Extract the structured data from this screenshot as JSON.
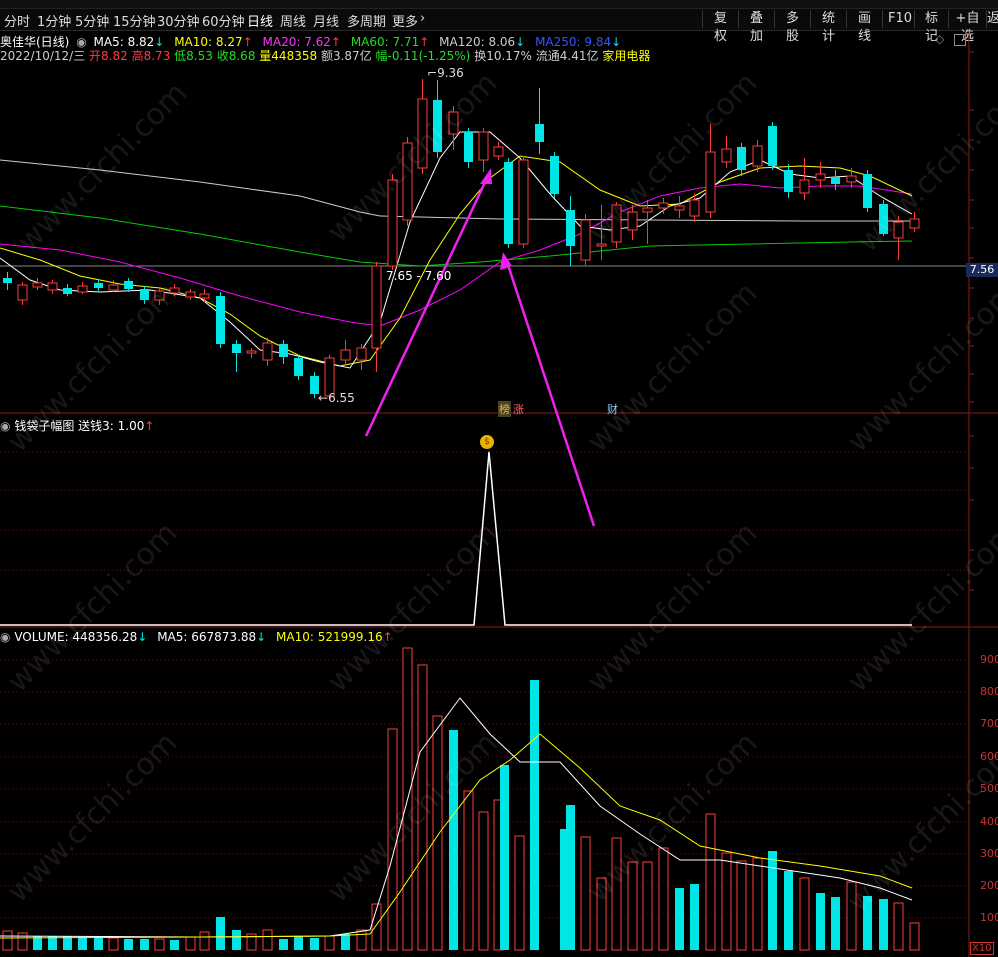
{
  "toolbar": {
    "period_tabs": [
      "分时",
      "1分钟",
      "5分钟",
      "15分钟",
      "30分钟",
      "60分钟",
      "日线",
      "周线",
      "月线",
      "多周期",
      "更多"
    ],
    "active_tab": "日线",
    "right_tools": [
      "复权",
      "叠加",
      "多股",
      "统计",
      "画线",
      "F10",
      "标记",
      "+自选",
      "返"
    ]
  },
  "stock": {
    "name_period": "奥佳华(日线)",
    "ma5": "MA5: 8.82",
    "ma10": "MA10: 8.27",
    "ma20": "MA20: 7.62",
    "ma60": "MA60: 7.71",
    "ma120": "MA120: 8.06",
    "ma250": "MA250: 9.84",
    "date": "2022/10/12/三",
    "open": "开8.82",
    "high": "高8.73",
    "low": "低8.53",
    "close": "收8.68",
    "volume": "量448358",
    "amount": "额3.87亿",
    "change": "幅-0.11(-1.25%)",
    "turnover": "换10.17%",
    "float_cap": "流通4.41亿",
    "industry": "家用电器"
  },
  "price_chart": {
    "high_label": "9.36",
    "low_label": "6.55",
    "range_label": "7.65 - 7.60",
    "current_price": "7.56",
    "tags": [
      "榜",
      "涨",
      "财"
    ]
  },
  "indicator": {
    "title": "钱袋子幅图",
    "value": "送钱3: 1.00"
  },
  "volume_panel": {
    "volume": "VOLUME: 448356.28",
    "ma5": "MA5: 667873.88",
    "ma10": "MA10: 521999.16",
    "unit": "X10",
    "y_ticks": [
      "900",
      "800",
      "700",
      "600",
      "500",
      "400",
      "300",
      "200",
      "100"
    ]
  },
  "watermark": "www.cfchi.com",
  "colors": {
    "up": "#ff3b3b",
    "down": "#00e6e6",
    "ma5": "#ffffff",
    "ma10": "#ffff00",
    "ma20": "#ff00ff",
    "ma60": "#00cc00",
    "ma120": "#cccccc",
    "ma250": "#3333ff",
    "arrow": "#ee22ee"
  }
}
